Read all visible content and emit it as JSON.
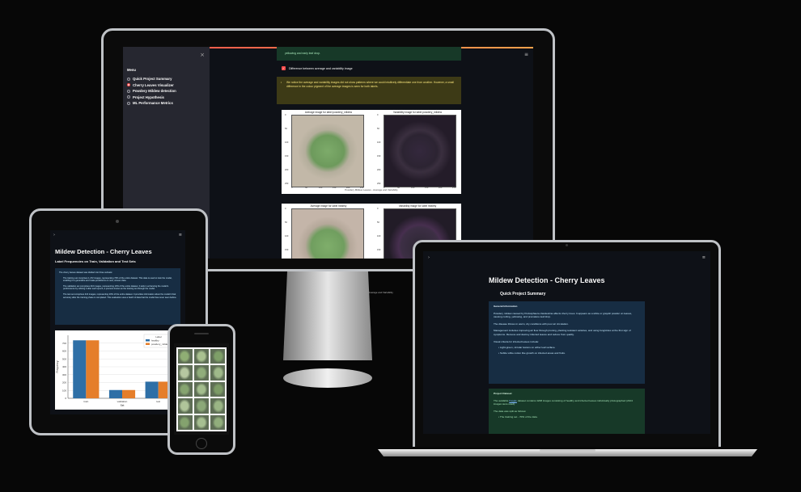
{
  "app": {
    "title": "Mildew Detection - Cherry Leaves"
  },
  "sidebar": {
    "menu_label": "Menu",
    "close_glyph": "×",
    "items": [
      {
        "label": "Quick Project Summary",
        "selected": false
      },
      {
        "label": "Cherry Leaves Visualizer",
        "selected": true
      },
      {
        "label": "Powdery Mildew detection",
        "selected": false
      },
      {
        "label": "Project Hypothesis",
        "selected": false
      },
      {
        "label": "ML Performance Metrics",
        "selected": false
      }
    ]
  },
  "monitor": {
    "top_green_text": "yellowing and early leaf drop.",
    "checkbox_label": "Difference between average and variability image",
    "info_text": "We notice the average and variability images did not show patterns where we could intuitively differentiate one from another. However, a small difference in the colour pigment of the average images is seen for both labels.",
    "figure1": {
      "left_title": "Average image for label powdery_mildew",
      "right_title": "Variability image for label powdery_mildew",
      "caption": "Powdery Mildew Leaves - Average and Variability"
    },
    "figure2": {
      "left_title": "Average image for label healthy",
      "right_title": "Variability image for label healthy",
      "caption": "Healthy Leaves - Average and Variability"
    },
    "axis_ticks_y": [
      "0",
      "50",
      "100",
      "150",
      "200",
      "250"
    ],
    "axis_ticks_x": [
      "0",
      "50",
      "100",
      "150",
      "200",
      "250"
    ],
    "hamburger": "≡"
  },
  "tablet": {
    "heading": "Mildew Detection - Cherry Leaves",
    "subheading": "Label Frequencies on Train, Validation and Test Sets",
    "info_intro": "The cherry leaves dataset was divided into three subsets:",
    "bullets": [
      "The training set comprises 1,472 images, representing 70% of the entire dataset. This data is used to train the model, enabling it to generalize and make predictions on new, unseen data.",
      "The validation set comprises 210 images, representing 10% of the entire dataset. It aids in enhancing the model's performance by refining it after each epoch, a process known as the training set through the model.",
      "The test set comprises 422 images, representing 20% of the entire dataset. It provides information about the model's final accuracy after the training phase is completed. This evaluation uses a batch of data that the model has never seen before."
    ],
    "chart_legend_title": "Label",
    "menu_glyph": "≡",
    "arrow_glyph": "›"
  },
  "chart_data": {
    "type": "bar",
    "categories": [
      "train",
      "validation",
      "test"
    ],
    "series": [
      {
        "name": "healthy",
        "values": [
          736,
          105,
          211
        ],
        "color": "#2e6fa6"
      },
      {
        "name": "powdery_mildew",
        "values": [
          736,
          105,
          211
        ],
        "color": "#e57e2a"
      }
    ],
    "xlabel": "Set",
    "ylabel": "Frequency",
    "ylim": [
      0,
      800
    ],
    "yticks": [
      "0",
      "100",
      "200",
      "300",
      "400",
      "500",
      "600",
      "700"
    ],
    "legend": "top-right",
    "grid": true
  },
  "laptop": {
    "heading": "Mildew Detection - Cherry Leaves",
    "subheading": "Quick Project Summary",
    "general_title": "General Information",
    "general_paragraphs": [
      "Powdery mildew caused by Podosphaera clandestina affects cherry trees. It appears as a white or grayish powder on leaves, causing curling, yellowing, and premature leaf drop.",
      "The disease thrives in warm, dry conditions with poor air circulation.",
      "Management includes improving air flow through pruning, planting resistant varieties, and using fungicides at the first sign of symptoms. Remove and destroy infected leaves and reduce from quality.",
      "Visual criteria for infected leaves include:"
    ],
    "general_bullets": [
      "Light-green, circular lesions on either leaf surface.",
      "Subtle white cotton like growth on infected areas and fruits."
    ],
    "dataset_title": "Project Dataset",
    "dataset_text_before": "The available ",
    "dataset_link": "Kaggle",
    "dataset_text_after": " dataset contains 4208 images consisting of healthy and infected leaves individually photographed (2104 images were used).",
    "split_text": "The data was split as follows:",
    "split_bullets": [
      "The training set - 70% of the data."
    ],
    "arrow_glyph": "›",
    "menu_glyph": "≡"
  },
  "phone": {
    "grid_label": "leaf montage"
  }
}
